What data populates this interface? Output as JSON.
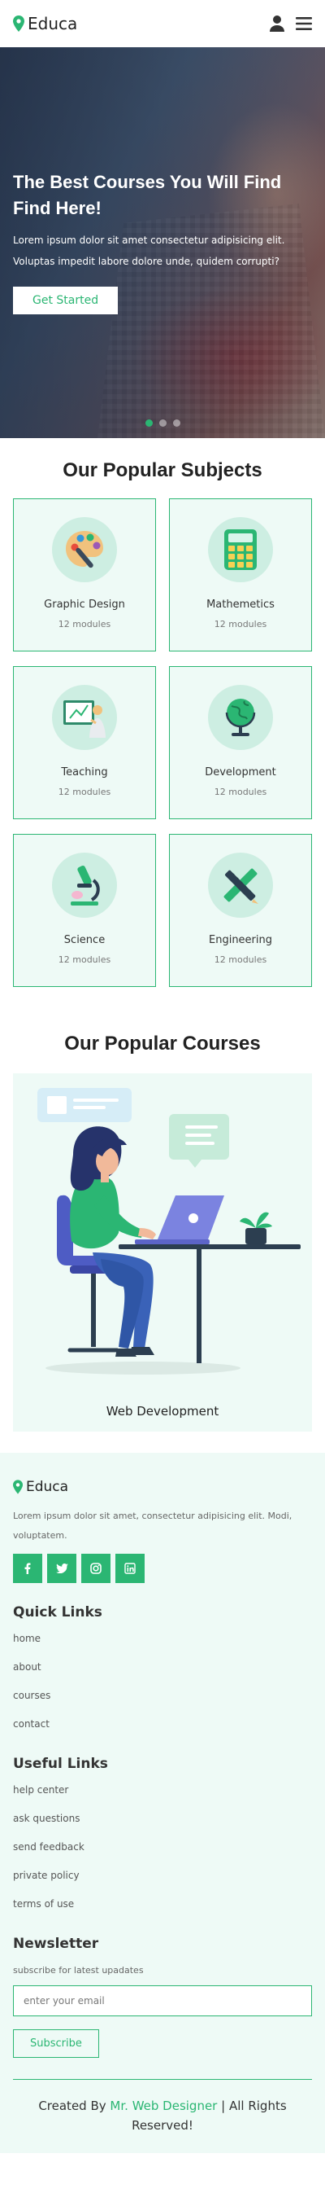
{
  "brand": {
    "name": "Educa",
    "accent": "#2bb673",
    "icons": [
      "map-pin-icon",
      "user-icon",
      "menu-icon"
    ]
  },
  "hero": {
    "title": "The Best Courses You Will Find Find Here!",
    "text": "Lorem ipsum dolor sit amet consectetur adipisicing elit. Voluptas impedit labore dolore unde, quidem corrupti?",
    "button": "Get Started",
    "slides": 3,
    "active_slide": 1
  },
  "subjects": {
    "title": "Our Popular Subjects",
    "items": [
      {
        "name": "Graphic Design",
        "modules": "12 modules",
        "icon": "palette-icon"
      },
      {
        "name": "Mathemetics",
        "modules": "12 modules",
        "icon": "calculator-icon"
      },
      {
        "name": "Teaching",
        "modules": "12 modules",
        "icon": "teacher-board-icon"
      },
      {
        "name": "Development",
        "modules": "12 modules",
        "icon": "globe-icon"
      },
      {
        "name": "Science",
        "modules": "12 modules",
        "icon": "microscope-icon"
      },
      {
        "name": "Engineering",
        "modules": "12 modules",
        "icon": "pencil-ruler-icon"
      }
    ]
  },
  "courses": {
    "title": "Our Popular Courses",
    "items": [
      {
        "name": "Web Development"
      }
    ]
  },
  "footer": {
    "brand": "Educa",
    "about": "Lorem ipsum dolor sit amet, consectetur adipisicing elit. Modi, voluptatem.",
    "socials": [
      "facebook-icon",
      "twitter-icon",
      "instagram-icon",
      "linkedin-icon"
    ],
    "quick_links": {
      "title": "Quick Links",
      "items": [
        "home",
        "about",
        "courses",
        "contact"
      ]
    },
    "useful_links": {
      "title": "Useful Links",
      "items": [
        "help center",
        "ask questions",
        "send feedback",
        "private policy",
        "terms of use"
      ]
    },
    "newsletter": {
      "title": "Newsletter",
      "subtitle": "subscribe for latest upadates",
      "placeholder": "enter your email",
      "button": "Subscribe"
    },
    "credit": {
      "prefix": "Created By",
      "author": "Mr. Web Designer",
      "suffix": "| All Rights Reserved!"
    }
  }
}
